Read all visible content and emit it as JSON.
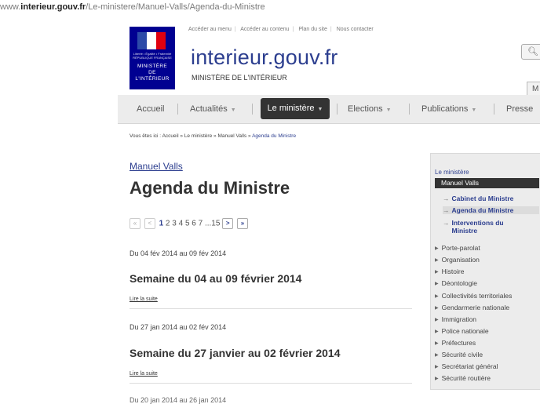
{
  "url": {
    "prefix": "www.",
    "domain": "interieur.gouv.fr",
    "path": "/Le-ministere/Manuel-Valls/Agenda-du-Ministre"
  },
  "topbar": [
    "Accéder au menu",
    "Accéder au contenu",
    "Plan du site",
    "Nous contacter"
  ],
  "logo": {
    "motto": "Liberté • Égalité • Fraternité",
    "republic": "RÉPUBLIQUE FRANÇAISE",
    "ministry": [
      "MINISTÈRE",
      "DE",
      "L'INTÉRIEUR"
    ]
  },
  "site": {
    "name": "interieur.gouv.fr",
    "subtitle": "MINISTÈRE DE L'INTÉRIEUR"
  },
  "header": {
    "search_icon": "magnifier-icon",
    "tab_right": "M"
  },
  "nav": {
    "items": [
      "Accueil",
      "Actualités",
      "Le ministère",
      "Elections",
      "Publications",
      "Presse"
    ],
    "active": "Le ministère"
  },
  "breadcrumb": {
    "prefix": "Vous êtes ici :",
    "items": [
      "Accueil",
      "Le ministère",
      "Manuel Valls"
    ],
    "current": "Agenda du Ministre",
    "sep": "»"
  },
  "main": {
    "person": "Manuel Valls",
    "title": "Agenda du Ministre",
    "pager": {
      "first": "«",
      "prev": "<",
      "pages": [
        "1",
        "2",
        "3",
        "4",
        "5",
        "6",
        "7",
        "...15"
      ],
      "current": "1",
      "next": ">",
      "last": "»"
    },
    "entries": [
      {
        "date": "Du 04 fév 2014 au 09 fév 2014",
        "heading": "Semaine du 04 au 09 février 2014",
        "more": "Lire la suite"
      },
      {
        "date": "Du 27 jan 2014 au 02 fév 2014",
        "heading": "Semaine du 27 janvier au 02 février 2014",
        "more": "Lire la suite"
      }
    ],
    "next_date": "Du 20 jan 2014 au 26 jan 2014"
  },
  "sidebar": {
    "title": "Le ministère",
    "active": "Manuel Valls",
    "sub": [
      "Cabinet du Ministre",
      "Agenda du Ministre",
      "Interventions du Ministre"
    ],
    "sub_selected": "Agenda du Ministre",
    "categories": [
      "Porte-parolat",
      "Organisation",
      "Histoire",
      "Déontologie",
      "Collectivités territoriales",
      "Gendarmerie nationale",
      "Immigration",
      "Police nationale",
      "Préfectures",
      "Sécurité civile",
      "Secrétariat général",
      "Sécurité routière"
    ]
  }
}
